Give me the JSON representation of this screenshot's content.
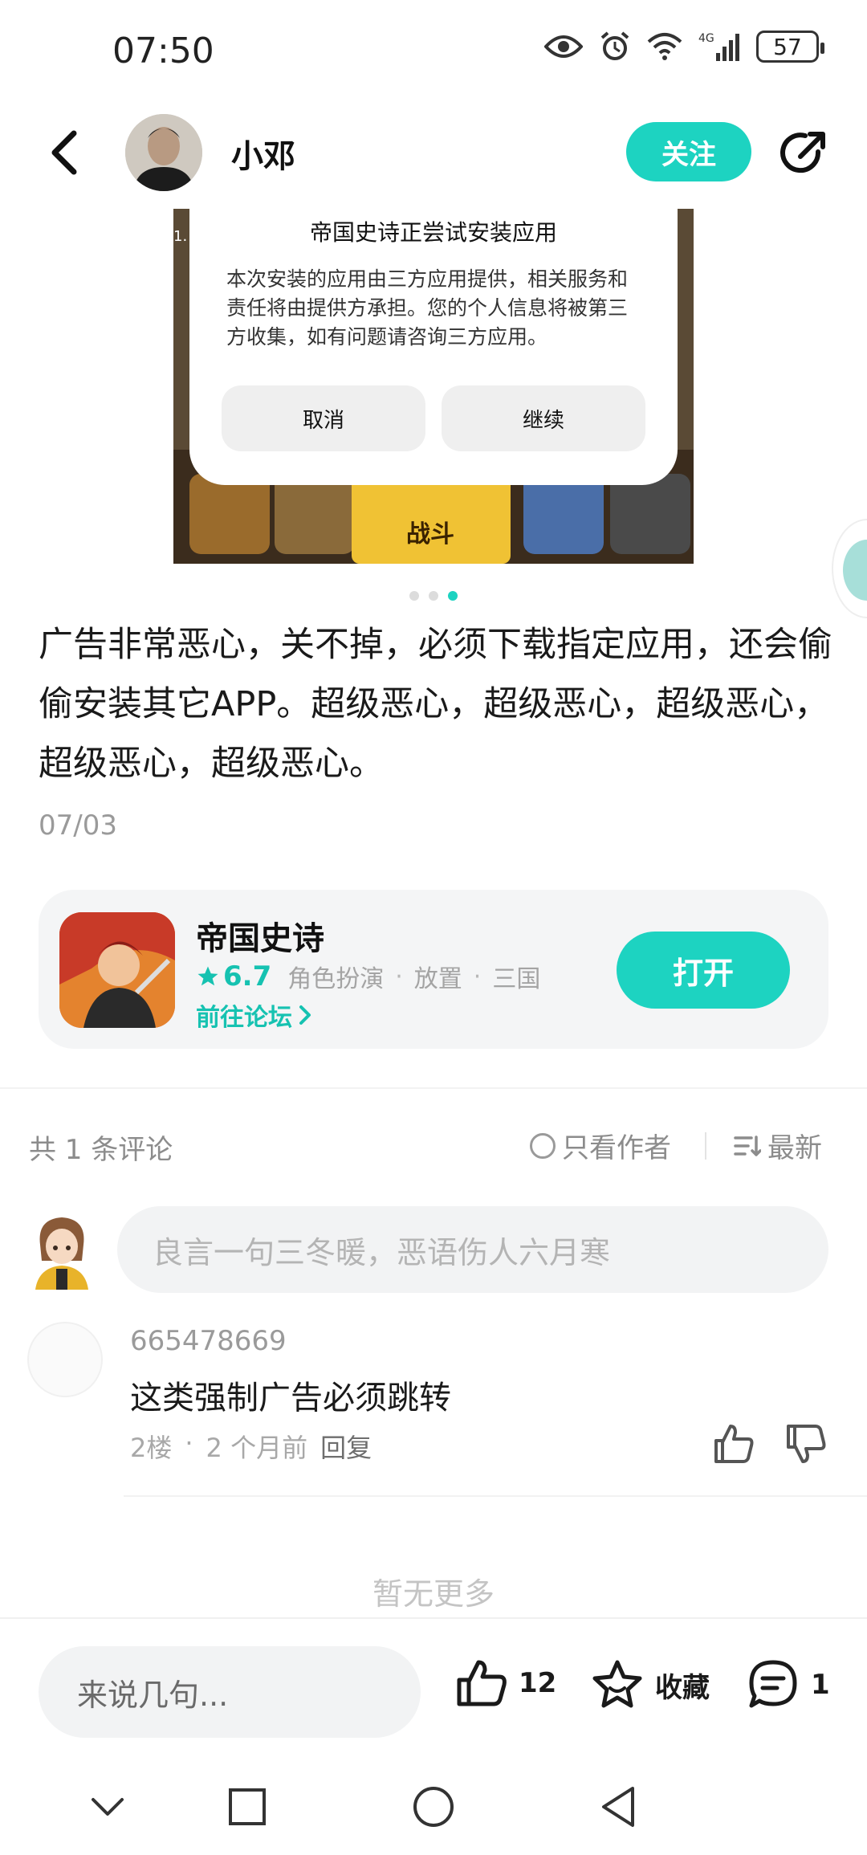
{
  "status_bar": {
    "time": "07:50",
    "battery": "57",
    "network": "4G"
  },
  "header": {
    "author_name": "小邓",
    "follow_label": "关注"
  },
  "install_dialog": {
    "title": "帝国史诗正尝试安装应用",
    "body": "本次安装的应用由三方应用提供，相关服务和责任将由提供方承担。您的个人信息将被第三方收集，如有问题请咨询三方应用。",
    "cancel_label": "取消",
    "continue_label": "继续"
  },
  "screenshot": {
    "battle_label": "战斗",
    "corner_text": "1."
  },
  "post": {
    "text": "广告非常恶心，关不掉，必须下载指定应用，还会偷偷安装其它APP。超级恶心，超级恶心，超级恶心，超级恶心，超级恶心。",
    "date": "07/03"
  },
  "app_card": {
    "name": "帝国史诗",
    "rating": "6.7",
    "tags": [
      "角色扮演",
      "放置",
      "三国"
    ],
    "forum_label": "前往论坛",
    "open_label": "打开"
  },
  "comments": {
    "count_label": "共 1 条评论",
    "author_only_label": "只看作者",
    "sort_label": "最新",
    "input_placeholder": "良言一句三冬暖，恶语伤人六月寒",
    "items": [
      {
        "user": "665478669",
        "text": "这类强制广告必须跳转",
        "floor": "2楼",
        "time": "2 个月前",
        "reply_label": "回复"
      }
    ],
    "no_more": "暂无更多"
  },
  "bottom_bar": {
    "input_placeholder": "来说几句...",
    "like_count": "12",
    "favorite_label": "收藏",
    "comment_count": "1"
  },
  "colors": {
    "accent": "#1dd3c1",
    "accent_text": "#16c2b1"
  }
}
